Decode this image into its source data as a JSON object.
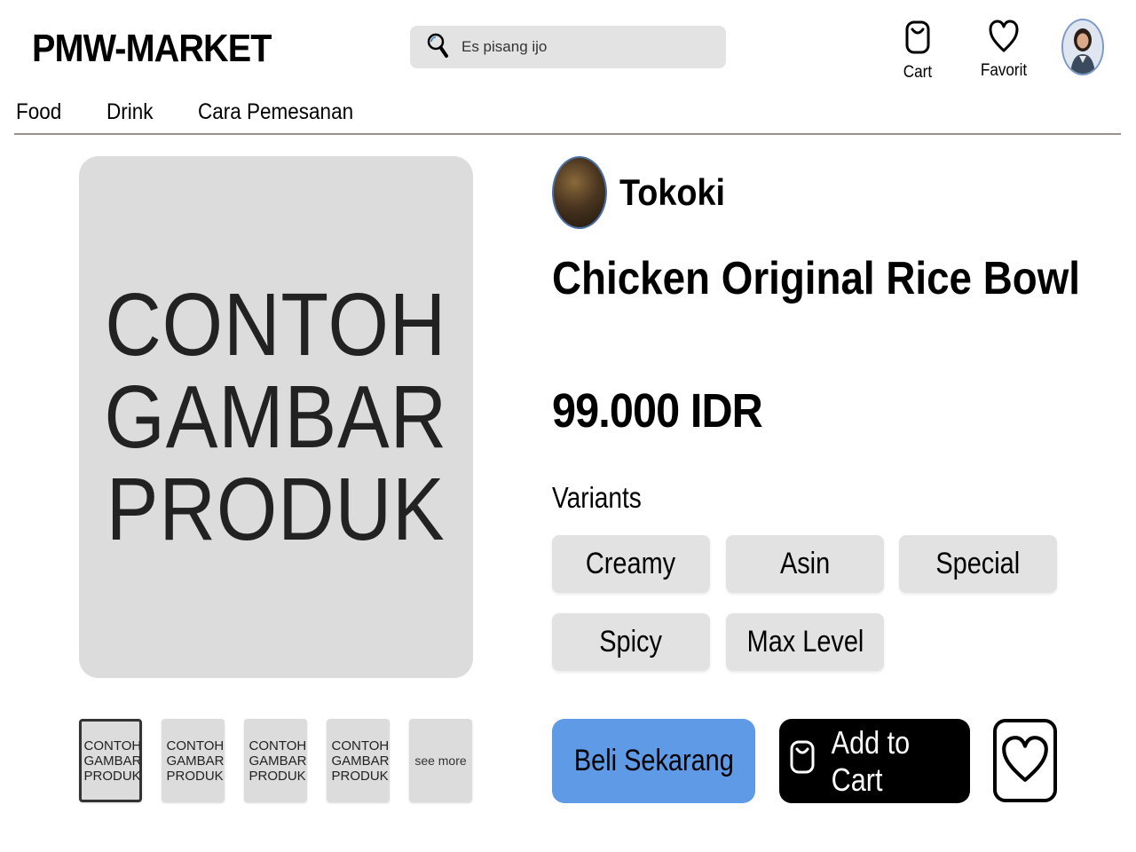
{
  "header": {
    "logo": "PMW-MARKET",
    "search": {
      "placeholder": "Es pisang ijo",
      "icon": "search-icon"
    },
    "cart_label": "Cart",
    "favorite_label": "Favorit"
  },
  "nav": {
    "items": [
      "Food",
      "Drink",
      "Cara Pemesanan"
    ]
  },
  "product": {
    "image_placeholder": [
      "CONTOH",
      "GAMBAR",
      "PRODUK"
    ],
    "thumbnails": [
      {
        "label": "CONTOH GAMBAR PRODUK"
      },
      {
        "label": "CONTOH GAMBAR PRODUK"
      },
      {
        "label": "CONTOH GAMBAR PRODUK"
      },
      {
        "label": "CONTOH GAMBAR PRODUK"
      }
    ],
    "see_more": "see more",
    "store_name": "Tokoki",
    "title": "Chicken Original Rice Bowl",
    "price": "99.000 IDR",
    "variants_label": "Variants",
    "variants": [
      "Creamy",
      "Asin",
      "Special",
      "Spicy",
      "Max Level"
    ]
  },
  "actions": {
    "buy_now": "Beli Sekarang",
    "add_to_cart": "Add to Cart"
  },
  "colors": {
    "buy_button": "#5e9ae6",
    "cart_button": "#000000",
    "variant_bg": "#e2e2e2",
    "image_placeholder_bg": "#dcdcdc"
  }
}
